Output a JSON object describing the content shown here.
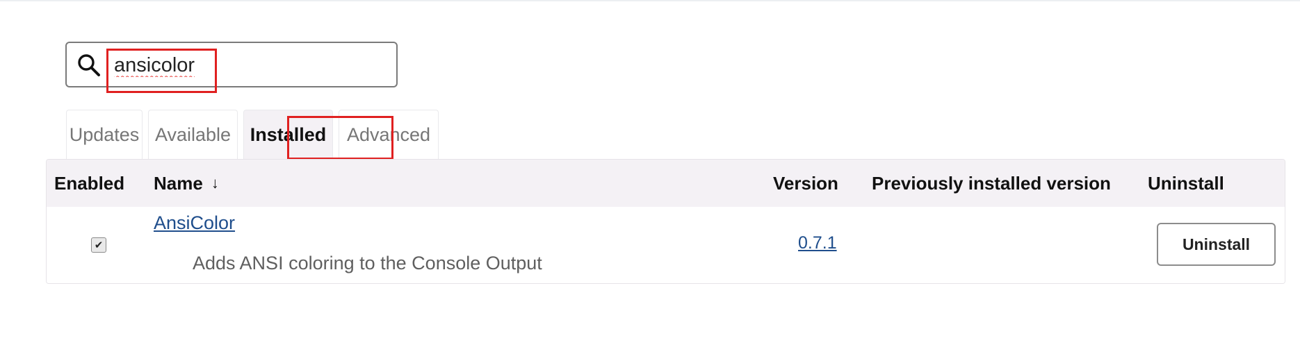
{
  "search": {
    "value": "ansicolor",
    "placeholder": ""
  },
  "tabs": [
    {
      "label": "Updates"
    },
    {
      "label": "Available"
    },
    {
      "label": "Installed"
    },
    {
      "label": "Advanced"
    }
  ],
  "active_tab": "Installed",
  "table": {
    "headers": {
      "enabled": "Enabled",
      "name": "Name",
      "name_sort_icon": "↓",
      "version": "Version",
      "previous": "Previously installed version",
      "uninstall": "Uninstall"
    },
    "rows": [
      {
        "enabled": true,
        "checkmark": "✔",
        "name": "AnsiColor",
        "description": "Adds ANSI coloring to the Console Output",
        "version": "0.7.1",
        "previous_version": "",
        "uninstall_label": "Uninstall"
      }
    ]
  },
  "colors": {
    "highlight_border": "#e02020",
    "link": "#1f4e8c",
    "header_bg": "#f4f1f5"
  }
}
